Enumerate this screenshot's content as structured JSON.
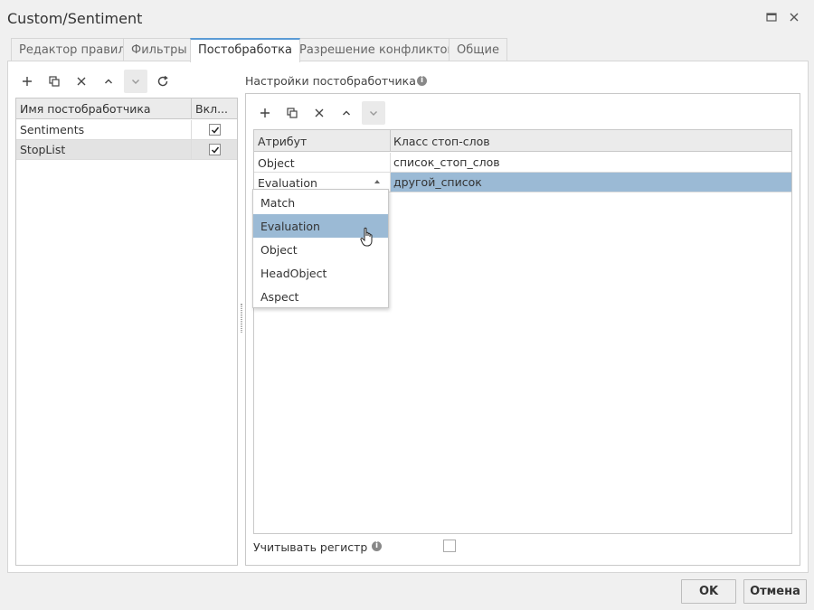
{
  "window": {
    "title": "Custom/Sentiment"
  },
  "icons": {
    "maximize": "maximize-icon",
    "close": "close-icon",
    "add": "plus-icon",
    "copy": "copy-icon",
    "delete": "x-icon",
    "up": "chevron-up-icon",
    "down": "chevron-down-icon",
    "refresh": "refresh-icon",
    "info": "info-icon",
    "check": "check-icon"
  },
  "tabs": [
    {
      "label": "Редактор правил",
      "active": false
    },
    {
      "label": "Фильтры",
      "active": false
    },
    {
      "label": "Постобработка",
      "active": true
    },
    {
      "label": "Разрешение конфликтов",
      "active": false
    },
    {
      "label": "Общие",
      "active": false
    }
  ],
  "left": {
    "columns": [
      "Имя постобработчика",
      "Вкл..."
    ],
    "rows": [
      {
        "name": "Sentiments",
        "enabled": true,
        "selected": false
      },
      {
        "name": "StopList",
        "enabled": true,
        "selected": true
      }
    ]
  },
  "right": {
    "section_title": "Настройки постобработчика",
    "columns": [
      "Атрибут",
      "Класс стоп-слов"
    ],
    "rows": [
      {
        "attribute": "Object",
        "stop_class": "список_стоп_слов"
      },
      {
        "attribute": "Evaluation",
        "stop_class": "другой_список"
      }
    ],
    "dropdown_options": [
      "Match",
      "Evaluation",
      "Object",
      "HeadObject",
      "Aspect"
    ],
    "dropdown_highlighted": "Evaluation",
    "case_label": "Учитывать регистр",
    "case_checked": false
  },
  "buttons": {
    "ok": "OK",
    "cancel": "Отмена"
  },
  "colors": {
    "accent": "#5b9bd5",
    "selection": "#9bbad5"
  }
}
